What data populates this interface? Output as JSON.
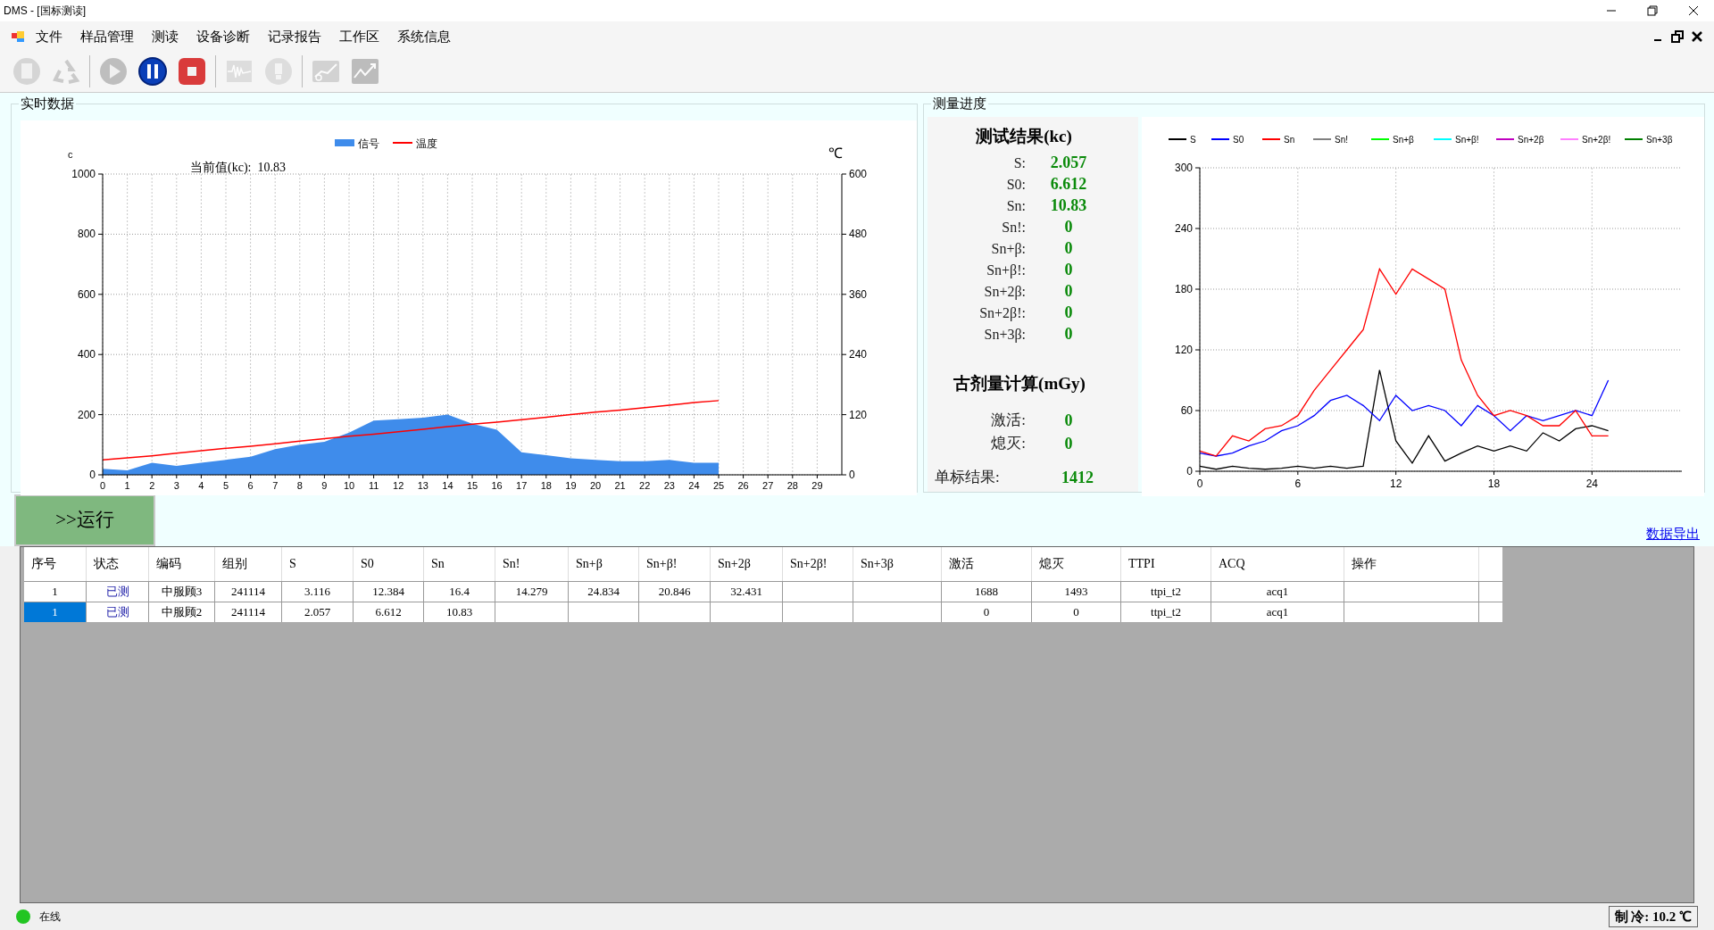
{
  "window": {
    "title": "DMS - [国标测读]"
  },
  "menu": [
    "文件",
    "样品管理",
    "测读",
    "设备诊断",
    "记录报告",
    "工作区",
    "系统信息"
  ],
  "toolbar": [
    {
      "kind": "document",
      "disabled": true
    },
    {
      "kind": "recycle",
      "disabled": true
    },
    {
      "kind": "play",
      "disabled": true
    },
    {
      "kind": "pause",
      "disabled": false
    },
    {
      "kind": "stop",
      "disabled": false
    },
    {
      "kind": "wave",
      "disabled": true
    },
    {
      "kind": "bulb",
      "disabled": true
    },
    {
      "kind": "curve",
      "disabled": true
    },
    {
      "kind": "trend",
      "disabled": true
    }
  ],
  "realtime": {
    "title": "实时数据",
    "current_label": "当前值(kc):",
    "current_value": "10.83",
    "chart_data": {
      "type": "area",
      "grid": true,
      "legend": "top",
      "ylabel": "c",
      "y2label": "℃",
      "xlim": [
        0,
        30
      ],
      "ylim": [
        0,
        1000
      ],
      "y2lim": [
        0,
        600
      ],
      "xticks": [
        0,
        1,
        2,
        3,
        4,
        5,
        6,
        7,
        8,
        9,
        10,
        11,
        12,
        13,
        14,
        15,
        16,
        17,
        18,
        19,
        20,
        21,
        22,
        23,
        24,
        25,
        26,
        27,
        28,
        29
      ],
      "yticks": [
        0,
        200,
        400,
        600,
        800,
        1000
      ],
      "y2ticks": [
        0,
        120,
        240,
        360,
        480,
        600
      ],
      "x": [
        0,
        1,
        2,
        3,
        4,
        5,
        6,
        7,
        8,
        9,
        10,
        11,
        12,
        13,
        14,
        15,
        16,
        17,
        18,
        19,
        20,
        21,
        22,
        23,
        24,
        25
      ],
      "series": [
        {
          "name": "信号",
          "color": "#3f8ceb",
          "type": "area",
          "values": [
            20,
            15,
            40,
            30,
            40,
            50,
            60,
            85,
            100,
            110,
            140,
            180,
            185,
            190,
            200,
            170,
            150,
            75,
            65,
            55,
            50,
            45,
            45,
            50,
            40,
            40
          ]
        },
        {
          "name": "温度",
          "color": "#ff0000",
          "type": "line",
          "axis": "y2",
          "values": [
            30,
            34,
            38,
            43,
            48,
            53,
            57,
            62,
            67,
            72,
            77,
            81,
            86,
            91,
            96,
            101,
            105,
            110,
            115,
            120,
            125,
            129,
            134,
            139,
            144,
            148
          ]
        }
      ]
    }
  },
  "progress": {
    "title": "测量进度",
    "results": {
      "title": "测试结果(kc)",
      "items": [
        {
          "label": "S:",
          "value": "2.057"
        },
        {
          "label": "S0:",
          "value": "6.612"
        },
        {
          "label": "Sn:",
          "value": "10.83"
        },
        {
          "label": "Sn!:",
          "value": "0"
        },
        {
          "label": "Sn+β:",
          "value": "0"
        },
        {
          "label": "Sn+β!:",
          "value": "0"
        },
        {
          "label": "Sn+2β:",
          "value": "0"
        },
        {
          "label": "Sn+2β!:",
          "value": "0"
        },
        {
          "label": "Sn+3β:",
          "value": "0"
        }
      ]
    },
    "dose": {
      "title": "古剂量计算(mGy)",
      "items": [
        {
          "label": "激活:",
          "value": "0"
        },
        {
          "label": "熄灭:",
          "value": "0"
        }
      ]
    },
    "single": {
      "label": "单标结果:",
      "value": "1412"
    },
    "chart_data": {
      "type": "line",
      "grid": true,
      "legend": "top",
      "xlim": [
        0,
        29.5
      ],
      "ylim": [
        0,
        300
      ],
      "xticks": [
        0,
        6,
        12,
        18,
        24
      ],
      "yticks": [
        0,
        60,
        120,
        180,
        240,
        300
      ],
      "x": [
        0,
        1,
        2,
        3,
        4,
        5,
        6,
        7,
        8,
        9,
        10,
        11,
        12,
        13,
        14,
        15,
        16,
        17,
        18,
        19,
        20,
        21,
        22,
        23,
        24,
        25
      ],
      "series": [
        {
          "name": "S",
          "color": "#000000",
          "values": [
            5,
            2,
            5,
            3,
            2,
            3,
            5,
            3,
            5,
            3,
            5,
            100,
            30,
            8,
            35,
            10,
            18,
            25,
            20,
            25,
            20,
            38,
            30,
            42,
            45,
            40
          ]
        },
        {
          "name": "S0",
          "color": "#0000ff",
          "values": [
            18,
            15,
            18,
            25,
            30,
            40,
            45,
            55,
            70,
            75,
            65,
            50,
            75,
            60,
            65,
            60,
            45,
            65,
            55,
            40,
            55,
            50,
            55,
            60,
            55,
            90
          ]
        },
        {
          "name": "Sn",
          "color": "#ff0000",
          "values": [
            20,
            15,
            35,
            30,
            42,
            45,
            55,
            80,
            100,
            120,
            140,
            200,
            175,
            200,
            190,
            180,
            110,
            75,
            55,
            60,
            55,
            45,
            45,
            60,
            35,
            35
          ]
        },
        {
          "name": "Sn!",
          "color": "#808080",
          "values": [
            null,
            null,
            null,
            null,
            null,
            null,
            null,
            null,
            null,
            null,
            null,
            null,
            null,
            null,
            null,
            null,
            null,
            null,
            null,
            null,
            null,
            null,
            null,
            null,
            null,
            null
          ]
        },
        {
          "name": "Sn+β",
          "color": "#00ff00",
          "values": [
            null,
            null,
            null,
            null,
            null,
            null,
            null,
            null,
            null,
            null,
            null,
            null,
            null,
            null,
            null,
            null,
            null,
            null,
            null,
            null,
            null,
            null,
            null,
            null,
            null,
            null
          ]
        },
        {
          "name": "Sn+β!",
          "color": "#00ffff",
          "values": [
            null,
            null,
            null,
            null,
            null,
            null,
            null,
            null,
            null,
            null,
            null,
            null,
            null,
            null,
            null,
            null,
            null,
            null,
            null,
            null,
            null,
            null,
            null,
            null,
            null,
            null
          ]
        },
        {
          "name": "Sn+2β",
          "color": "#c000c0",
          "values": [
            null,
            null,
            null,
            null,
            null,
            null,
            null,
            null,
            null,
            null,
            null,
            null,
            null,
            null,
            null,
            null,
            null,
            null,
            null,
            null,
            null,
            null,
            null,
            null,
            null,
            null
          ]
        },
        {
          "name": "Sn+2β!",
          "color": "#ff80ff",
          "values": [
            null,
            null,
            null,
            null,
            null,
            null,
            null,
            null,
            null,
            null,
            null,
            null,
            null,
            null,
            null,
            null,
            null,
            null,
            null,
            null,
            null,
            null,
            null,
            null,
            null,
            null
          ]
        },
        {
          "name": "Sn+3β",
          "color": "#008000",
          "values": [
            null,
            null,
            null,
            null,
            null,
            null,
            null,
            null,
            null,
            null,
            null,
            null,
            null,
            null,
            null,
            null,
            null,
            null,
            null,
            null,
            null,
            null,
            null,
            null,
            null,
            null
          ]
        }
      ]
    }
  },
  "run_button": ">>运行",
  "export_link": "数据导出",
  "table": {
    "columns": [
      "序号",
      "状态",
      "编码",
      "组别",
      "S",
      "S0",
      "Sn",
      "Sn!",
      "Sn+β",
      "Sn+β!",
      "Sn+2β",
      "Sn+2β!",
      "Sn+3β",
      "激活",
      "熄灭",
      "TTPI",
      "ACQ",
      "操作"
    ],
    "rows": [
      {
        "selected": false,
        "cells": [
          "1",
          "已测",
          "中服顾3",
          "241114",
          "3.116",
          "12.384",
          "16.4",
          "14.279",
          "24.834",
          "20.846",
          "32.431",
          null,
          null,
          "1688",
          "1493",
          "ttpi_t2",
          "acq1",
          null
        ]
      },
      {
        "selected": true,
        "cells": [
          "1",
          "已测",
          "中服顾2",
          "241114",
          "2.057",
          "6.612",
          "10.83",
          null,
          null,
          null,
          null,
          null,
          null,
          "0",
          "0",
          "ttpi_t2",
          "acq1",
          null
        ]
      }
    ]
  },
  "status": {
    "online": true,
    "text": "在线",
    "cooling": "制 冷: 10.2 ℃"
  }
}
